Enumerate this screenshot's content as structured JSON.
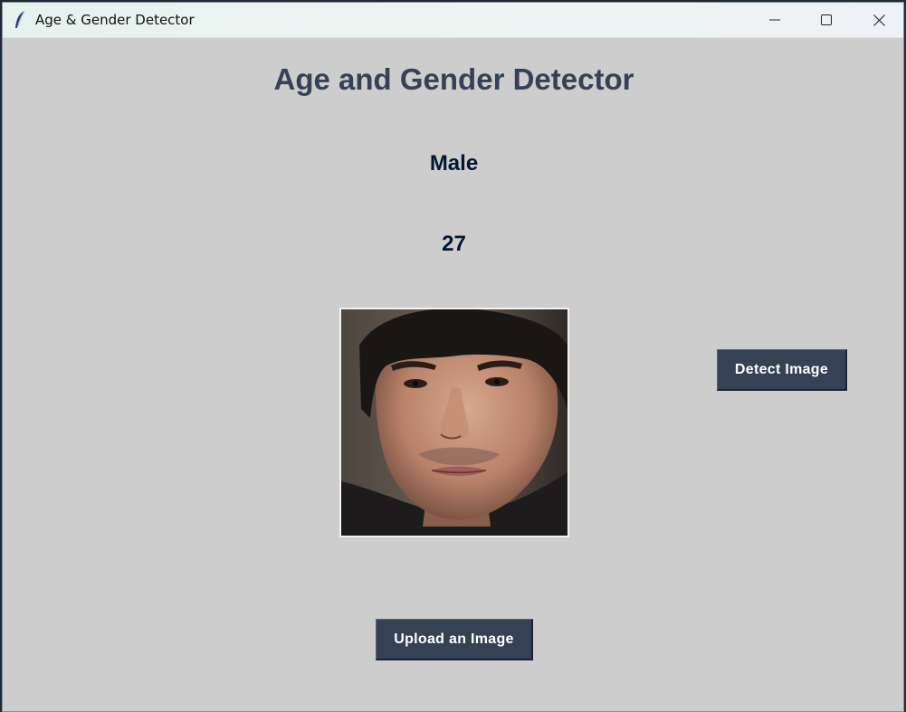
{
  "window": {
    "title": "Age & Gender Detector",
    "controls": {
      "minimize_icon": "minimize-icon",
      "maximize_icon": "maximize-icon",
      "close_icon": "close-icon"
    },
    "app_icon": "feather-icon"
  },
  "main": {
    "heading": "Age and Gender Detector",
    "gender_result": "Male",
    "age_result": "27",
    "detect_button_label": "Detect Image",
    "upload_button_label": "Upload an Image"
  },
  "colors": {
    "background": "#cdcdcd",
    "heading": "#364156",
    "result_text": "#011638",
    "button_bg": "#364156",
    "button_text": "#ffffff"
  }
}
